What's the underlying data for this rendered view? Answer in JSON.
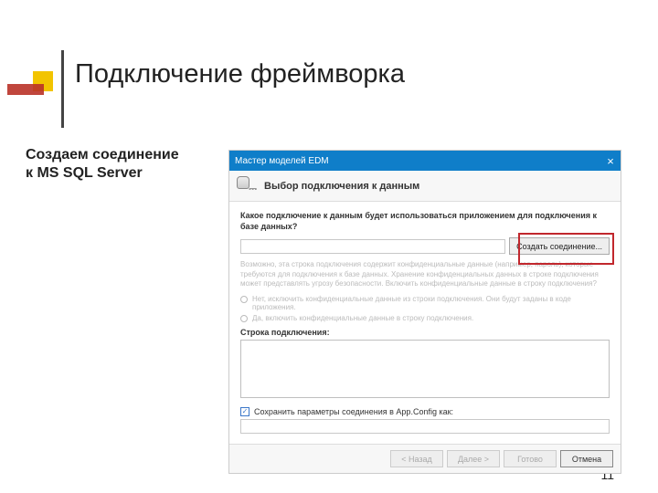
{
  "slide": {
    "title": "Подключение фреймворка",
    "side_text": "Создаем соединение к MS SQL Server",
    "page_number": "11"
  },
  "dialog": {
    "window_title": "Мастер моделей EDM",
    "close_label": "×",
    "subtitle": "Выбор подключения к данным",
    "prompt": "Какое подключение к данным будет использоваться приложением для подключения к базе данных?",
    "create_button": "Создать соединение...",
    "warning_text": "Возможно, эта строка подключения содержит конфиденциальные данные (например, пароль), которые требуются для подключения к базе данных. Хранение конфиденциальных данных в строке подключения может представлять угрозу безопасности. Включить конфиденциальные данные в строку подключения?",
    "radio_no": "Нет, исключить конфиденциальные данные из строки подключения. Они будут заданы в коде приложения.",
    "radio_yes": "Да, включить конфиденциальные данные в строку подключения.",
    "conn_string_label": "Строка подключения:",
    "save_checkbox": "Сохранить параметры соединения в App.Config как:",
    "buttons": {
      "back": "< Назад",
      "next": "Далее >",
      "finish": "Готово",
      "cancel": "Отмена"
    }
  }
}
